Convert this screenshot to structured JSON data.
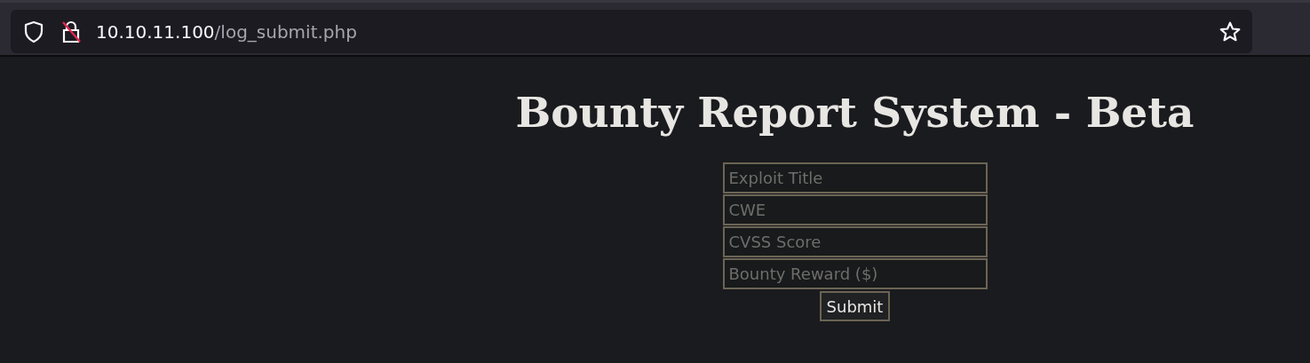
{
  "browser": {
    "url_host": "10.10.11.100",
    "url_path": "/log_submit.php"
  },
  "page": {
    "title": "Bounty Report System - Beta",
    "fields": [
      {
        "placeholder": "Exploit Title"
      },
      {
        "placeholder": "CWE"
      },
      {
        "placeholder": "CVSS Score"
      },
      {
        "placeholder": "Bounty Reward ($)"
      }
    ],
    "submit": "Submit"
  }
}
